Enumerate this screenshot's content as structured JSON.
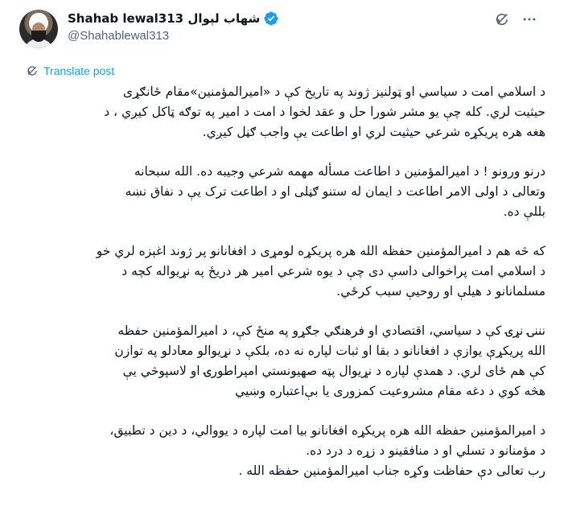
{
  "author": {
    "display_name": "Shahab lewal313 شهاب لېوال",
    "handle": "@Shahablewal313",
    "verified": true
  },
  "icons": {
    "verified": "verified-badge-icon",
    "grok": "grok-icon",
    "more": "more-icon",
    "translate": "translate-icon"
  },
  "colors": {
    "accent": "#1d9bf0",
    "secondary_text": "#536471"
  },
  "translate_label": "Translate post",
  "post": {
    "paragraphs": [
      {
        "lines": [
          "د اسلامي امت د سیاسي او ټولنیز ژوند په تاریخ کې د «امیرالمؤمنین»مقام ځانګړی",
          "حیثیت لري. کله چې یو مشر شورا حل و عقد لخوا د امت د امیر په توګه ټاکل کیږي ، د",
          "هغه هره پریکړه شرعي حیثیت لري او اطاعت یې واجب ګڼل کیږي."
        ]
      },
      {
        "lines": [
          "درنو ورونو ! د امیرالمؤمنین د اطاعت مسأله مهمه شرعي وجیبه ده. الله سبحانه",
          "وتعالی د اولی الامر اطاعت د ایمان له ستنو ګڼلی او د اطاعت ترک یې د نفاق نښه",
          "بللې ده."
        ]
      },
      {
        "lines": [
          "که څه هم د امیرالمؤمنین حفظه الله هره پریکړه لومړی د افغانانو پر ژوند اغېزه لري خو",
          "د اسلامي امت پراخوالی داسې دی چې د یوه شرعي امیر هر دریځ په نړیواله کچه د",
          "مسلمانانو د هیلې او روحیې سبب کرځي."
        ]
      },
      {
        "lines": [
          "نننۍ نړۍ کې د سیاسي، اقتصادي او فرهنګي جګړو په منځ کې، د امیرالمؤمنین حفظه",
          "الله پریکړې یوازې د افغانانو د بقا او ثبات لپاره نه ده، بلکې د نړیوالو معادلو په توازن",
          "کې هم ځای لري. د همدې لپاره د نړیوال پټه صهیونستي امپراطورۍ او لاسپوڅي یې",
          "هڅه کوي د دغه مقام مشروعیت کمزوری یا بې‌اعتباره وښیي"
        ]
      },
      {
        "lines": [
          "د امیرالمؤمنین حفظه الله هره پریکړه افغانانو بیا امت لپاره د یووالي، د دین د تطبیق،",
          "د مؤمنانو د تسلي او د منافقینو د زړه د درد ده.",
          "رب تعالی دې حفاظت وکړه جناب امیرالمؤمنین حفظه الله ."
        ]
      }
    ]
  }
}
